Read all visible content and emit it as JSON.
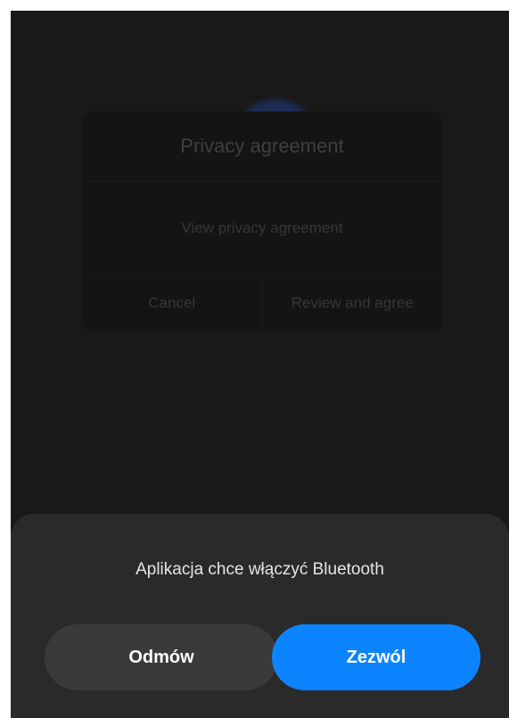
{
  "privacy_dialog": {
    "title": "Privacy agreement",
    "link": "View privacy agreement",
    "cancel": "Cancel",
    "agree": "Review and agree"
  },
  "bluetooth_sheet": {
    "message": "Aplikacja chce włączyć Bluetooth",
    "deny": "Odmów",
    "allow": "Zezwól"
  },
  "colors": {
    "background": "#191919",
    "sheet": "#2a2a2a",
    "allow_button": "#0d84ff",
    "deny_button": "#3a3a3a"
  }
}
